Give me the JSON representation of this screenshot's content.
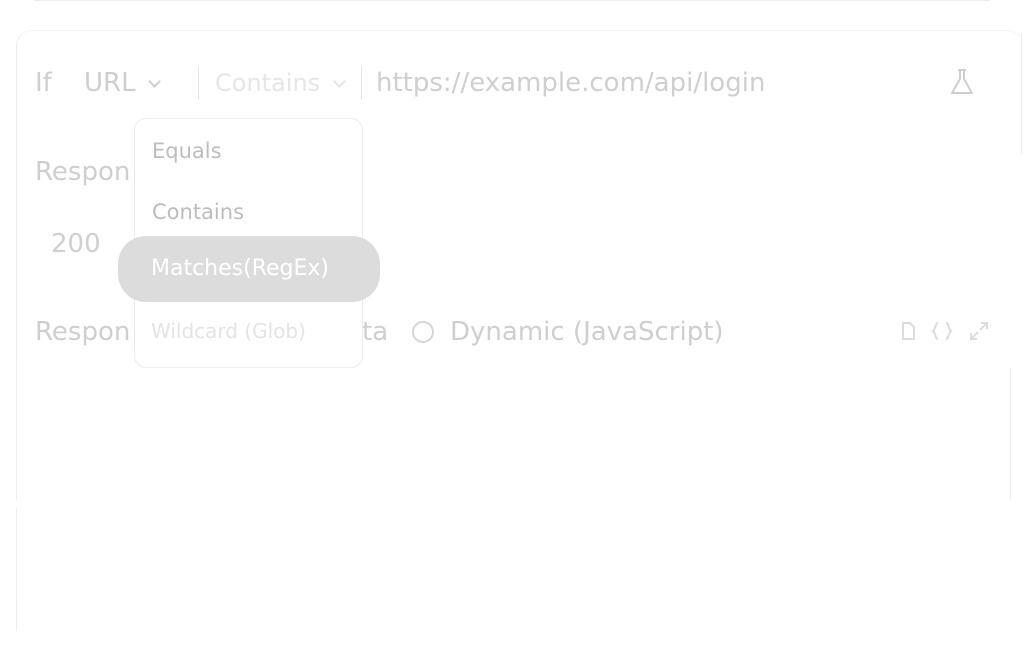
{
  "condition": {
    "if_label": "If",
    "field_label": "URL",
    "operator_label": "Contains",
    "value": "https://example.com/api/login"
  },
  "operator_menu": {
    "items": [
      "Equals",
      "Contains",
      "Matches(RegEx)",
      "Wildcard (Glob)"
    ],
    "highlighted": "Matches(RegEx)"
  },
  "response": {
    "status_label_partial": "Respon",
    "status_value": "200",
    "data_label_partial": "Respon",
    "data_label_tail": "ta",
    "mode_option": "Dynamic (JavaScript)"
  },
  "icons": {
    "test": "flask-icon",
    "copy": "copy-icon",
    "format": "braces-icon",
    "expand": "expand-icon"
  }
}
